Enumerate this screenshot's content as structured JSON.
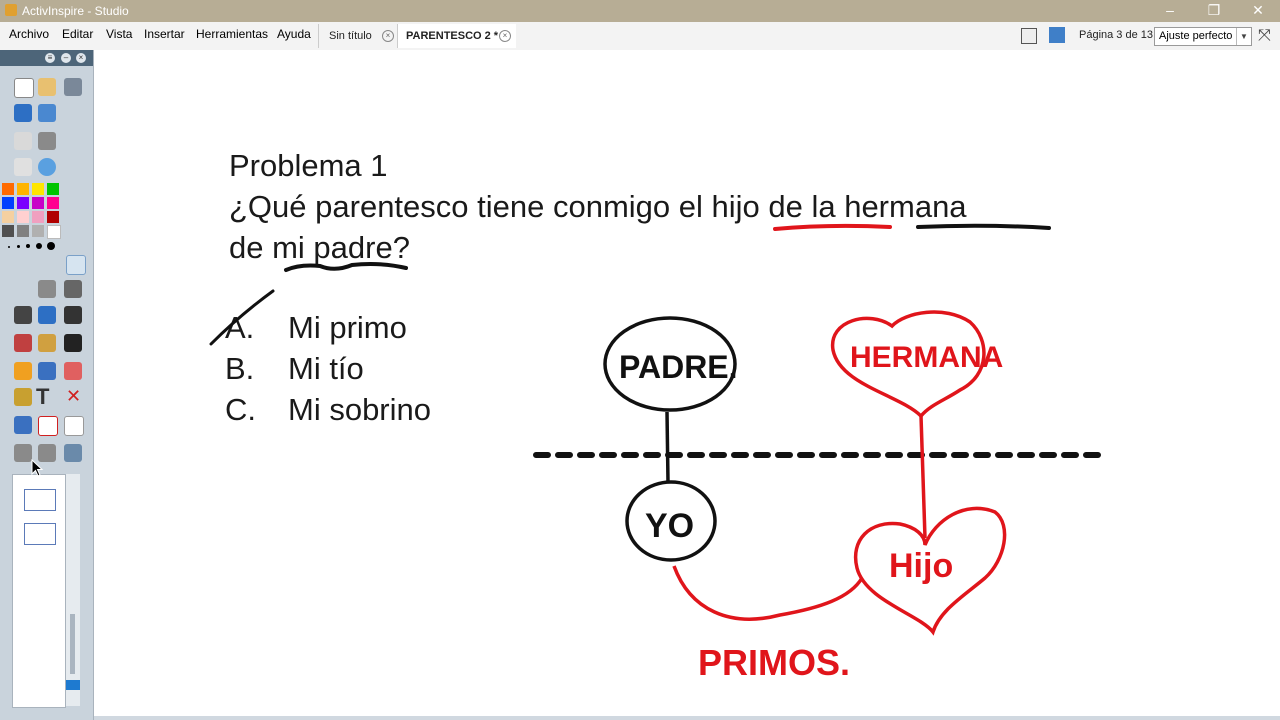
{
  "window": {
    "title": "ActivInspire - Studio"
  },
  "menu": {
    "items": [
      "Archivo",
      "Editar",
      "Vista",
      "Insertar",
      "Herramientas",
      "Ayuda"
    ]
  },
  "tabs": [
    {
      "label": "Sin título"
    },
    {
      "label": "PARENTESCO 2  *"
    }
  ],
  "page_indicator": "Página 3 de 13",
  "zoom": {
    "value": "Ajuste perfecto"
  },
  "flipchart": {
    "title": "Problema 1",
    "question_line1": "¿Qué parentesco tiene conmigo el hijo de la hermana",
    "question_line2": "de mi padre?",
    "answers": [
      {
        "letter": "A.",
        "text": "Mi primo"
      },
      {
        "letter": "B.",
        "text": "Mi tío"
      },
      {
        "letter": "C.",
        "text": "Mi sobrino"
      }
    ]
  },
  "diagram": {
    "padre": "PADRE.",
    "yo": "YO",
    "hermana": "HERMANA",
    "hijo": "Hijo",
    "primos": "PRIMOS."
  },
  "colors": {
    "ink_black": "#111111",
    "ink_red": "#e0151b",
    "titlebar": "#b7ad95",
    "toolbox": "#c9d3dc"
  },
  "palette": [
    "#ff6a00",
    "#ffb400",
    "#ffe600",
    "#9cff00",
    "#00c400",
    "#0040ff",
    "#7a00ff",
    "#c800c8",
    "#ff00b4",
    "#ff0040",
    "#f5d0a0",
    "#ffd0d0",
    "#e090e0",
    "#f0a0c0",
    "#b00000",
    "#505050",
    "#808080",
    "#a0a0a0",
    "#c8c8c8",
    "#ffffff"
  ]
}
